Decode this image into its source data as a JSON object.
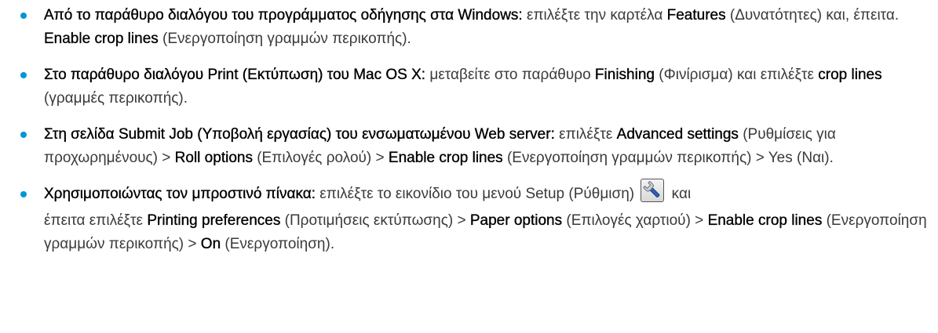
{
  "items": [
    {
      "lead": "Από το παράθυρο διαλόγου του προγράμματος οδήγησης στα Windows:",
      "t1": " επιλέξτε την καρτέλα ",
      "b1": "Features",
      "t2": " (Δυνατότητες) και, έπειτα. ",
      "b2": "Enable crop lines",
      "t3": " (Ενεργοποίηση γραμμών περικοπής)."
    },
    {
      "lead": "Στο παράθυρο διαλόγου Print (Εκτύπωση) του Mac OS X:",
      "t1": " μεταβείτε στο παράθυρο ",
      "b1": "Finishing",
      "t2": " (Φινίρισμα) και επιλέξτε ",
      "b2": "crop lines",
      "t3": " (γραμμές περικοπής)."
    },
    {
      "lead": "Στη σελίδα Submit Job (Υποβολή εργασίας) του ενσωματωμένου Web server:",
      "t1": " επιλέξτε ",
      "b1": "Advanced settings",
      "t2": " (Ρυθμίσεις για προχωρημένους) > ",
      "b2": "Roll options",
      "t3": " (Επιλογές ρολού) > ",
      "b3": "Enable crop lines",
      "t4": " (Ενεργοποίηση γραμμών περικοπής) > Yes (Ναι)."
    },
    {
      "lead": "Χρησιμοποιώντας τον μπροστινό πίνακα:",
      "t1": " επιλέξτε το εικονίδιο του μενού Setup (Ρύθμιση) ",
      "icon": "wrench-icon",
      "t2": " και",
      "t3": "έπειτα επιλέξτε ",
      "b1": "Printing preferences",
      "t4": " (Προτιμήσεις εκτύπωσης) > ",
      "b2": "Paper options",
      "t5": " (Επιλογές χαρτιού) > ",
      "b3": "Enable crop lines",
      "t6": " (Ενεργοποίηση γραμμών περικοπής) > ",
      "b4": "On",
      "t7": " (Ενεργοποίηση)."
    }
  ],
  "colors": {
    "bullet": "#0096d6",
    "text": "#3a3a3a",
    "emphasis": "#000000"
  }
}
